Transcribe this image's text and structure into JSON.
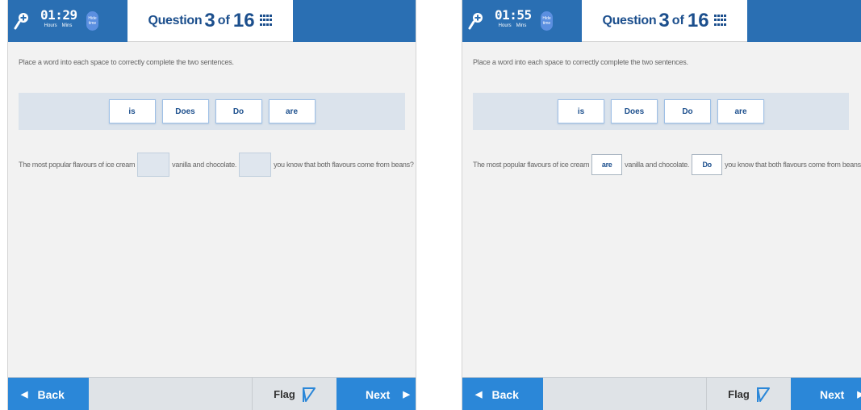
{
  "panels": [
    {
      "timer": {
        "time": "01:29",
        "hours_label": "Hours",
        "mins_label": "Mins"
      },
      "hide_time_label": "Hide time",
      "question": {
        "prefix": "Question",
        "current": "3",
        "of": "of",
        "total": "16"
      },
      "instruction": "Place a word into each space to correctly complete the two sentences.",
      "word_bank": [
        "is",
        "Does",
        "Do",
        "are"
      ],
      "sentence": {
        "part1": "The most popular flavours of ice cream",
        "blank1": "",
        "part2": "vanilla and chocolate.",
        "blank2": "",
        "part3": "you know that both flavours come from beans?"
      },
      "footer": {
        "back_label": "Back",
        "flag_label": "Flag",
        "next_label": "Next"
      }
    },
    {
      "timer": {
        "time": "01:55",
        "hours_label": "Hours",
        "mins_label": "Mins"
      },
      "hide_time_label": "Hide time",
      "question": {
        "prefix": "Question",
        "current": "3",
        "of": "of",
        "total": "16"
      },
      "instruction": "Place a word into each space to correctly complete the two sentences.",
      "word_bank": [
        "is",
        "Does",
        "Do",
        "are"
      ],
      "sentence": {
        "part1": "The most popular flavours of ice cream",
        "blank1": "are",
        "part2": "vanilla and chocolate.",
        "blank2": "Do",
        "part3": "you know that both flavours come from beans?"
      },
      "footer": {
        "back_label": "Back",
        "flag_label": "Flag",
        "next_label": "Next"
      }
    }
  ],
  "colors": {
    "header_blue": "#2a6fb3",
    "button_blue": "#2b87d8",
    "title_navy": "#1c4f8d",
    "word_bank_bg": "#dbe3ec",
    "flag_blue": "#2b87d8"
  },
  "icons": {
    "zoom": "magnifier-plus-icon",
    "question_grid": "grid-icon",
    "flag": "flag-icon",
    "back_arrow": "left-arrow-icon",
    "next_arrow": "right-arrow-icon"
  }
}
